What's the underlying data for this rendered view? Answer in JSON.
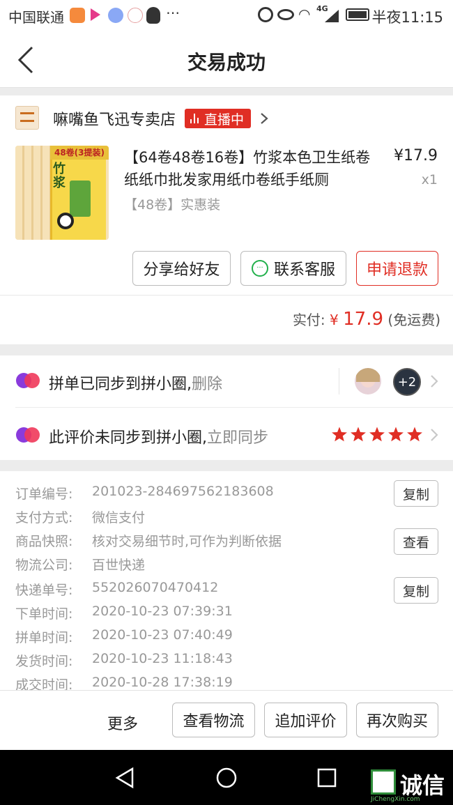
{
  "status_bar": {
    "carrier": "中国联通",
    "icons": [
      "taobao-icon",
      "video-icon",
      "music-icon",
      "fm-icon",
      "qq-icon",
      "more-dots-icon"
    ],
    "right_icons": [
      "alarm-icon",
      "eye-icon",
      "wifi-icon",
      "signal-icon",
      "battery-icon"
    ],
    "network": "4G",
    "time": "半夜11:15"
  },
  "nav": {
    "title": "交易成功"
  },
  "shop": {
    "name": "嘛嘴鱼飞迅专卖店",
    "live_label": "直播中"
  },
  "product": {
    "image_label": "48卷(3提装)",
    "image_brand": "竹浆",
    "title": "【64卷48卷16卷】竹浆本色卫生纸卷纸纸巾批发家用纸巾卷纸手纸厕",
    "price": "¥17.9",
    "qty": "x1",
    "spec": "【48卷】实惠装"
  },
  "actions": {
    "share": "分享给好友",
    "contact": "联系客服",
    "refund": "申请退款"
  },
  "payment": {
    "label": "实付:",
    "currency": "¥",
    "amount": "17.9",
    "note": "(免运费)"
  },
  "group": {
    "synced_text": "拼单已同步到拼小圈,",
    "synced_action": "删除",
    "extra_count": "+2",
    "review_text": "此评价未同步到拼小圈,",
    "review_action": "立即同步",
    "rating": 5
  },
  "order_info": {
    "rows": [
      {
        "label": "订单编号:",
        "value": "201023-284697562183608",
        "button": "复制"
      },
      {
        "label": "支付方式:",
        "value": "微信支付"
      },
      {
        "label": "商品快照:",
        "value": "核对交易细节时,可作为判断依据",
        "button": "查看"
      },
      {
        "label": "物流公司:",
        "value": "百世快递"
      },
      {
        "label": "快递单号:",
        "value": "552026070470412",
        "button": "复制"
      },
      {
        "label": "下单时间:",
        "value": "2020-10-23 07:39:31"
      },
      {
        "label": "拼单时间:",
        "value": "2020-10-23 07:40:49"
      },
      {
        "label": "发货时间:",
        "value": "2020-10-23 11:18:43"
      },
      {
        "label": "成交时间:",
        "value": "2020-10-28 17:38:19"
      }
    ]
  },
  "bottom": {
    "more": "更多",
    "logistics": "查看物流",
    "add_review": "追加评价",
    "rebuy": "再次购买"
  },
  "watermark": {
    "text": "诚信",
    "sub": "JiChengXin.com"
  },
  "colors": {
    "accent": "#e02e24",
    "star": "#e02e24"
  }
}
